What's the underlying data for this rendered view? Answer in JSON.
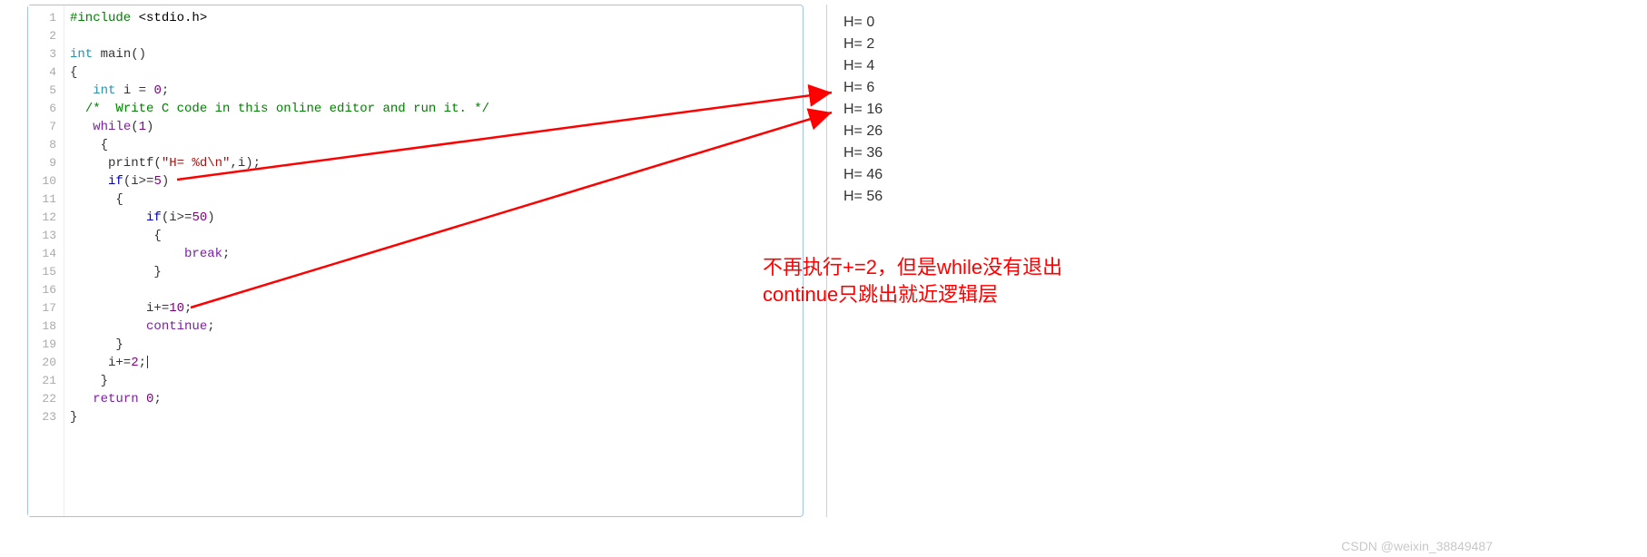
{
  "code": {
    "lines": [
      {
        "n": "1",
        "tokens": [
          {
            "t": "#include ",
            "c": "tok-preproc"
          },
          {
            "t": "<stdio.h>",
            "c": "tok-header"
          }
        ]
      },
      {
        "n": "2",
        "tokens": []
      },
      {
        "n": "3",
        "tokens": [
          {
            "t": "int",
            "c": "tok-type"
          },
          {
            "t": " main",
            "c": "tok-ident"
          },
          {
            "t": "()",
            "c": "tok-punc"
          }
        ]
      },
      {
        "n": "4",
        "tokens": [
          {
            "t": "{",
            "c": "tok-punc"
          }
        ]
      },
      {
        "n": "5",
        "tokens": [
          {
            "t": "   ",
            "c": ""
          },
          {
            "t": "int",
            "c": "tok-type"
          },
          {
            "t": " i ",
            "c": "tok-ident"
          },
          {
            "t": "= ",
            "c": "tok-punc"
          },
          {
            "t": "0",
            "c": "tok-num"
          },
          {
            "t": ";",
            "c": "tok-punc"
          }
        ]
      },
      {
        "n": "6",
        "tokens": [
          {
            "t": "  ",
            "c": ""
          },
          {
            "t": "/*  Write C code in this online editor and run it. */",
            "c": "tok-comment"
          }
        ]
      },
      {
        "n": "7",
        "tokens": [
          {
            "t": "   ",
            "c": ""
          },
          {
            "t": "while",
            "c": "tok-while"
          },
          {
            "t": "(",
            "c": "tok-punc"
          },
          {
            "t": "1",
            "c": "tok-num"
          },
          {
            "t": ")",
            "c": "tok-punc"
          }
        ]
      },
      {
        "n": "8",
        "tokens": [
          {
            "t": "    {",
            "c": "tok-punc"
          }
        ]
      },
      {
        "n": "9",
        "tokens": [
          {
            "t": "     printf",
            "c": "tok-ident"
          },
          {
            "t": "(",
            "c": "tok-punc"
          },
          {
            "t": "\"H= %d\\n\"",
            "c": "tok-string"
          },
          {
            "t": ",i);",
            "c": "tok-punc"
          }
        ]
      },
      {
        "n": "10",
        "tokens": [
          {
            "t": "     ",
            "c": ""
          },
          {
            "t": "if",
            "c": "tok-keyword"
          },
          {
            "t": "(i>=",
            "c": "tok-punc"
          },
          {
            "t": "5",
            "c": "tok-num"
          },
          {
            "t": ")",
            "c": "tok-punc"
          }
        ]
      },
      {
        "n": "11",
        "tokens": [
          {
            "t": "      {",
            "c": "tok-punc"
          }
        ]
      },
      {
        "n": "12",
        "tokens": [
          {
            "t": "          ",
            "c": ""
          },
          {
            "t": "if",
            "c": "tok-keyword"
          },
          {
            "t": "(i>=",
            "c": "tok-punc"
          },
          {
            "t": "50",
            "c": "tok-num"
          },
          {
            "t": ")",
            "c": "tok-punc"
          }
        ]
      },
      {
        "n": "13",
        "tokens": [
          {
            "t": "           {",
            "c": "tok-punc"
          }
        ]
      },
      {
        "n": "14",
        "tokens": [
          {
            "t": "               ",
            "c": ""
          },
          {
            "t": "break",
            "c": "tok-break"
          },
          {
            "t": ";",
            "c": "tok-punc"
          }
        ]
      },
      {
        "n": "15",
        "tokens": [
          {
            "t": "           }",
            "c": "tok-punc"
          }
        ]
      },
      {
        "n": "16",
        "tokens": []
      },
      {
        "n": "17",
        "tokens": [
          {
            "t": "          i+=",
            "c": "tok-ident"
          },
          {
            "t": "10",
            "c": "tok-num"
          },
          {
            "t": ";",
            "c": "tok-punc"
          }
        ]
      },
      {
        "n": "18",
        "tokens": [
          {
            "t": "          ",
            "c": ""
          },
          {
            "t": "continue",
            "c": "tok-continue"
          },
          {
            "t": ";",
            "c": "tok-punc"
          }
        ]
      },
      {
        "n": "19",
        "tokens": [
          {
            "t": "      }",
            "c": "tok-punc"
          }
        ]
      },
      {
        "n": "20",
        "tokens": [
          {
            "t": "     i+=",
            "c": "tok-ident"
          },
          {
            "t": "2",
            "c": "tok-num"
          },
          {
            "t": ";",
            "c": "tok-punc"
          }
        ],
        "cursor": true
      },
      {
        "n": "21",
        "tokens": [
          {
            "t": "    }",
            "c": "tok-punc"
          }
        ]
      },
      {
        "n": "22",
        "tokens": [
          {
            "t": "   ",
            "c": ""
          },
          {
            "t": "return",
            "c": "tok-return"
          },
          {
            "t": " ",
            "c": ""
          },
          {
            "t": "0",
            "c": "tok-num"
          },
          {
            "t": ";",
            "c": "tok-punc"
          }
        ]
      },
      {
        "n": "23",
        "tokens": [
          {
            "t": "}",
            "c": "tok-punc"
          }
        ]
      }
    ]
  },
  "output": {
    "lines": [
      "H= 0",
      "H= 2",
      "H= 4",
      "H= 6",
      "H= 16",
      "H= 26",
      "H= 36",
      "H= 46",
      "H= 56"
    ]
  },
  "annotation": {
    "line1": "不再执行+=2，但是while没有退出",
    "line2": "continue只跳出就近逻辑层"
  },
  "watermark": "CSDN @weixin_38849487"
}
